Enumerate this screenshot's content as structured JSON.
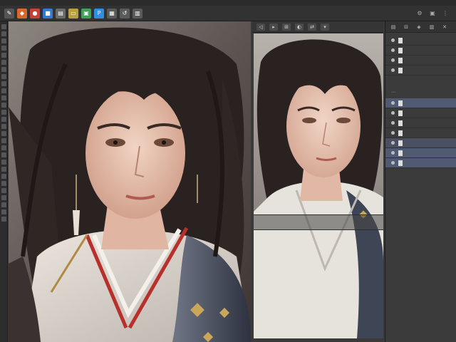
{
  "menubar": {
    "items": [
      "",
      "",
      "",
      "",
      "",
      "",
      "",
      ""
    ]
  },
  "appbar": {
    "icons": [
      {
        "name": "brush-app-icon",
        "glyph": "✎",
        "color": "#555555"
      },
      {
        "name": "orange-app-icon",
        "glyph": "◆",
        "color": "#d9682b"
      },
      {
        "name": "red-app-icon",
        "glyph": "●",
        "color": "#c8403a"
      },
      {
        "name": "blue-app-icon",
        "glyph": "■",
        "color": "#3579d0"
      },
      {
        "name": "window-app-icon",
        "glyph": "▤",
        "color": "#6a6a6a"
      },
      {
        "name": "folder-app-icon",
        "glyph": "▭",
        "color": "#b8a040"
      },
      {
        "name": "green-app-icon",
        "glyph": "▣",
        "color": "#3fa05a"
      },
      {
        "name": "photoshop-app-icon",
        "glyph": "P",
        "color": "#2f8ee0"
      },
      {
        "name": "grid-app-icon",
        "glyph": "▦",
        "color": "#5a5a5a"
      },
      {
        "name": "undo-app-icon",
        "glyph": "↺",
        "color": "#5a5a5a"
      },
      {
        "name": "layer-app-icon",
        "glyph": "▥",
        "color": "#5a5a5a"
      }
    ],
    "right_icons": [
      "⚙",
      "▣",
      "⋮"
    ]
  },
  "side_toolbar": {
    "buttons": [
      "◁",
      "▸",
      "⊞",
      "◐",
      "⇄",
      "▾"
    ]
  },
  "rightpanel": {
    "tabs": [
      "▤",
      "⊟",
      "◈",
      "▥",
      "✕"
    ],
    "layers_top": [
      "",
      "",
      "",
      ""
    ],
    "layers_bottom": [
      "",
      "",
      "",
      "",
      "",
      "",
      ""
    ],
    "selected_index": 4
  },
  "colors": {
    "accent": "#505a72",
    "panel": "#3b3b3b"
  }
}
